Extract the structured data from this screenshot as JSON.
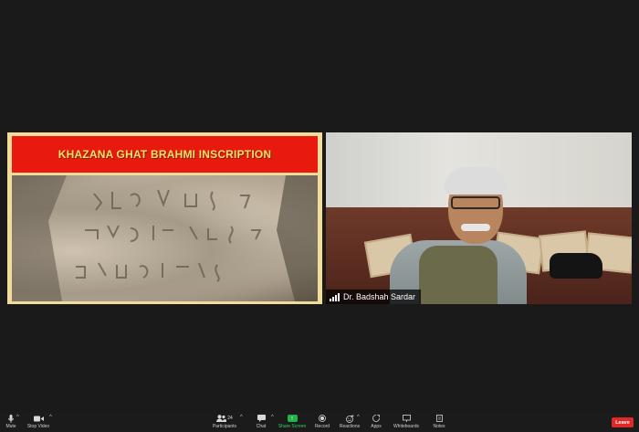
{
  "shared_screen": {
    "slide_title": "KHAZANA GHAT BRAHMI  INSCRIPTION"
  },
  "participant": {
    "name": "Dr. Badshah Sardar"
  },
  "toolbar": {
    "mute_label": "Mute",
    "stop_video_label": "Stop Video",
    "participants_label": "Participants",
    "participants_count": "24",
    "chat_label": "Chat",
    "share_screen_label": "Share Screen",
    "record_label": "Record",
    "reactions_label": "Reactions",
    "apps_label": "Apps",
    "whiteboards_label": "Whiteboards",
    "notes_label": "Notes",
    "leave_label": "Leave"
  },
  "colors": {
    "background": "#1a1a1a",
    "slide_banner": "#e81a10",
    "slide_title_text": "#f5e06a",
    "share_green": "#22b24c",
    "leave_red": "#e02828"
  }
}
